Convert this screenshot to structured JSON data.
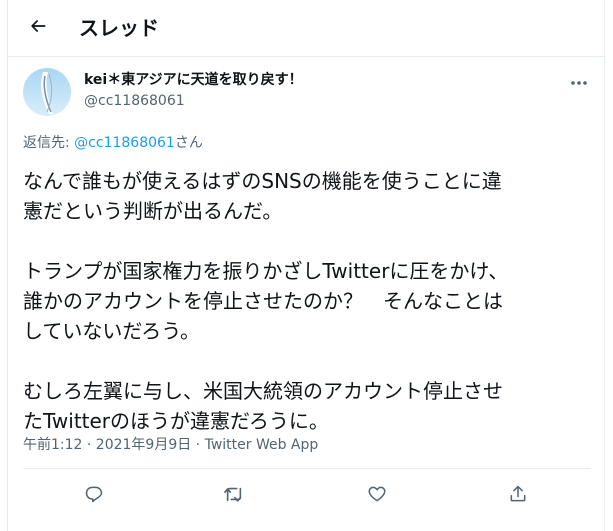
{
  "header": {
    "title": "スレッド",
    "back_icon": "arrow-left-icon"
  },
  "tweet": {
    "display_name": "kei＊東アジアに天道を取り戻す！",
    "handle": "@cc11868061",
    "reply_prefix": "返信先: ",
    "reply_to": "@cc11868061",
    "reply_suffix": "さん",
    "paragraphs": [
      [
        "なんで誰もが使えるはずのSNSの機能を使うことに違",
        "憲だという判断が出るんだ。"
      ],
      [
        "トランプが国家権力を振りかざしTwitterに圧をかけ、",
        "誰かのアカウントを停止させたのか？　そんなことは",
        "していないだろう。"
      ],
      [
        "むしろ左翼に与し、米国大統領のアカウント停止させ",
        "たTwitterのほうが違憲だろうに。"
      ]
    ],
    "timestamp": "午前1:12 · 2021年9月9日 · Twitter Web App"
  },
  "actions": [
    {
      "name": "reply",
      "icon": "reply-icon"
    },
    {
      "name": "retweet",
      "icon": "retweet-icon"
    },
    {
      "name": "like",
      "icon": "heart-icon"
    },
    {
      "name": "share",
      "icon": "share-icon"
    }
  ],
  "colors": {
    "text": "#0f1419",
    "secondary": "#536471",
    "link": "#1d9bf0",
    "border": "#e6ecf0"
  }
}
